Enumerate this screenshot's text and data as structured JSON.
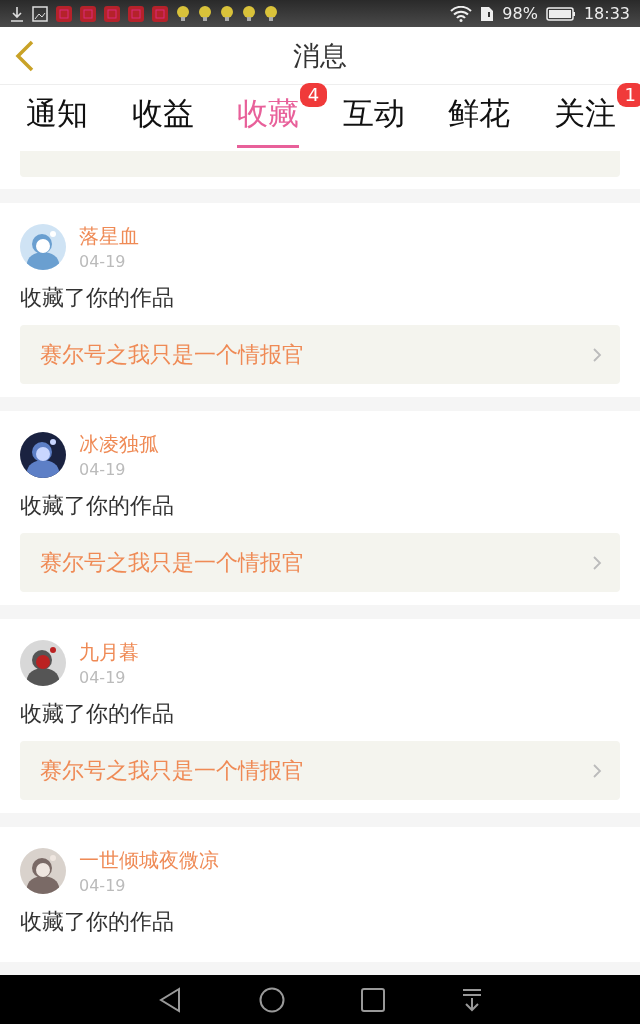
{
  "status_bar": {
    "battery": "98%",
    "time": "18:33"
  },
  "header": {
    "title": "消息"
  },
  "tabs": [
    {
      "label": "通知",
      "selected": false
    },
    {
      "label": "收益",
      "selected": false
    },
    {
      "label": "收藏",
      "selected": true,
      "badge": "4"
    },
    {
      "label": "互动",
      "selected": false
    },
    {
      "label": "鲜花",
      "selected": false
    },
    {
      "label": "关注",
      "selected": false,
      "badge": "1"
    }
  ],
  "items": [
    {
      "kind": "partial"
    },
    {
      "kind": "favorite",
      "user": "落星血",
      "date": "04-19",
      "action": "收藏了你的作品",
      "work": "赛尔号之我只是一个情报官"
    },
    {
      "kind": "favorite",
      "user": "冰凌独孤",
      "date": "04-19",
      "action": "收藏了你的作品",
      "work": "赛尔号之我只是一个情报官"
    },
    {
      "kind": "favorite",
      "user": "九月暮",
      "date": "04-19",
      "action": "收藏了你的作品",
      "work": "赛尔号之我只是一个情报官"
    },
    {
      "kind": "favorite",
      "user": "一世倾城夜微凉",
      "date": "04-19",
      "action": "收藏了你的作品"
    }
  ]
}
